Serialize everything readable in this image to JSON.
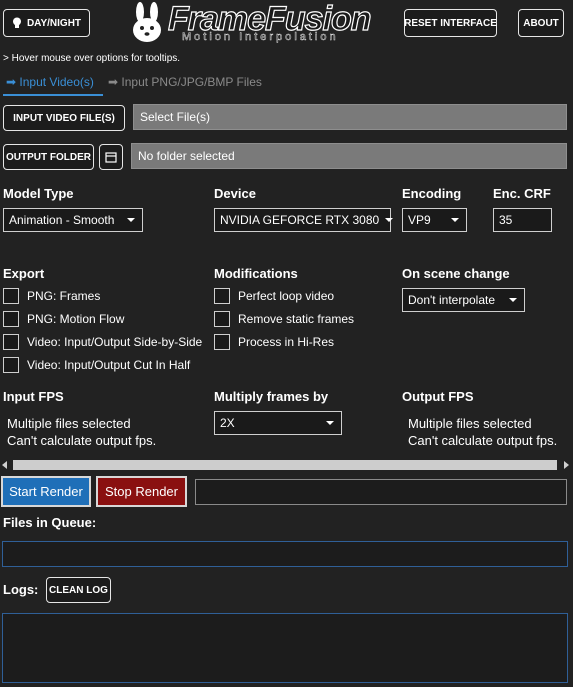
{
  "header": {
    "day_night_label": "DAY/NIGHT",
    "logo_title": "FrameFusion",
    "logo_subtitle": "Motion Interpolation",
    "reset_label": "RESET INTERFACE",
    "about_label": "ABOUT",
    "hint": "> Hover mouse over options for tooltips."
  },
  "tabs": [
    {
      "label": "➡ Input Video(s)",
      "active": true
    },
    {
      "label": "➡ Input PNG/JPG/BMP Files",
      "active": false
    }
  ],
  "input": {
    "button_label": "INPUT VIDEO FILE(S)",
    "value": "Select File(s)"
  },
  "output": {
    "button_label": "OUTPUT FOLDER",
    "value": "No folder selected"
  },
  "settings": {
    "model_type": {
      "label": "Model Type",
      "value": "Animation - Smooth"
    },
    "device": {
      "label": "Device",
      "value": "NVIDIA GEFORCE RTX 3080"
    },
    "encoding": {
      "label": "Encoding",
      "value": "VP9"
    },
    "crf": {
      "label": "Enc. CRF",
      "value": "35"
    }
  },
  "export": {
    "label": "Export",
    "options": [
      "PNG: Frames",
      "PNG: Motion Flow",
      "Video: Input/Output Side-by-Side",
      "Video: Input/Output Cut In Half"
    ]
  },
  "modifications": {
    "label": "Modifications",
    "options": [
      "Perfect loop video",
      "Remove static frames",
      "Process in Hi-Res"
    ]
  },
  "scene_change": {
    "label": "On scene change",
    "value": "Don't interpolate"
  },
  "fps": {
    "input_label": "Input FPS",
    "input_line1": "Multiple files selected",
    "input_line2": "Can't calculate output fps.",
    "multiply_label": "Multiply frames by",
    "multiply_value": "2X",
    "output_label": "Output FPS",
    "output_line1": "Multiple files selected",
    "output_line2": "Can't calculate output fps."
  },
  "render": {
    "start_label": "Start Render",
    "stop_label": "Stop Render"
  },
  "queue": {
    "label": "Files in Queue:"
  },
  "logs": {
    "label": "Logs:",
    "clean_label": "CLEAN LOG"
  },
  "colors": {
    "background": "#222222",
    "accent_blue": "#1f6fb8",
    "stop_red": "#8a1010",
    "field_gray": "#7a7a7a",
    "tab_active": "#3a8fd6"
  }
}
